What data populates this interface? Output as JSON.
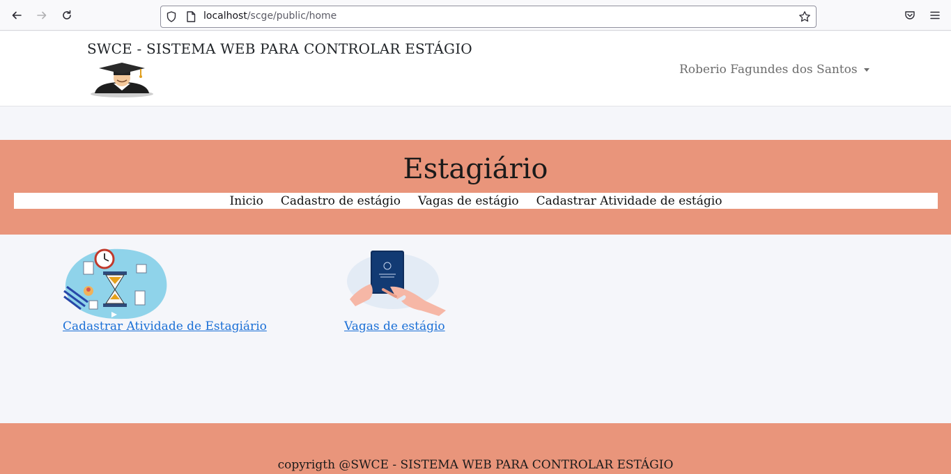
{
  "browser": {
    "url_host": "localhost",
    "url_path": "/scge/public/home"
  },
  "header": {
    "site_title": "SWCE - SISTEMA WEB PARA CONTROLAR ESTÁGIO",
    "user_name": "Roberio Fagundes dos Santos"
  },
  "banner": {
    "title": "Estagiário",
    "menu": [
      {
        "label": "Inicio"
      },
      {
        "label": "Cadastro de estágio"
      },
      {
        "label": "Vagas de estágio"
      },
      {
        "label": "Cadastrar Atividade de estágio"
      }
    ]
  },
  "cards": [
    {
      "label": "Cadastrar Atividade de Estagiário",
      "icon": "hourglass-activity-icon"
    },
    {
      "label": "Vagas de estágio",
      "icon": "work-card-icon"
    }
  ],
  "footer": {
    "text": "copyrigth @SWCE - SISTEMA WEB PARA CONTROLAR ESTÁGIO"
  },
  "colors": {
    "banner": "#e9957b",
    "link": "#1a6fd6",
    "page_bg": "#f5f6fa"
  }
}
